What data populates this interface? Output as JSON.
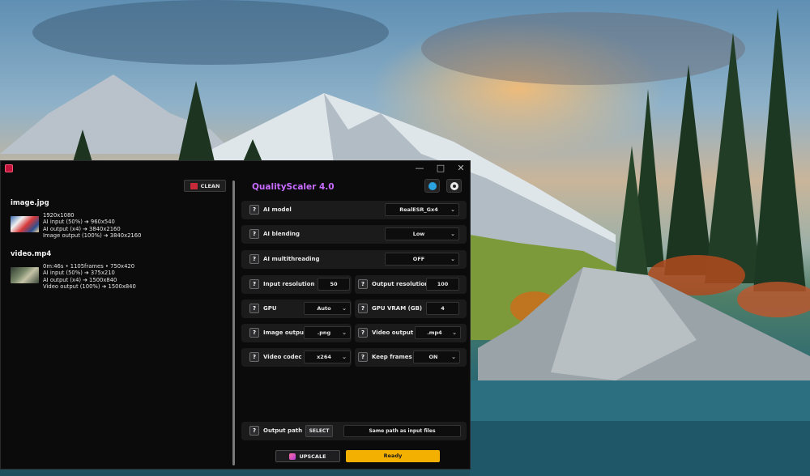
{
  "window": {
    "title_controls": [
      "—",
      "□",
      "✕"
    ]
  },
  "file_list": {
    "clean_label": "CLEAN",
    "files": [
      {
        "name": "image.jpg",
        "type": "image",
        "lines": [
          "1920x1080",
          "AI input (50%) ➔ 960x540",
          "AI output (x4) ➔ 3840x2160",
          "Image output (100%) ➔ 3840x2160"
        ]
      },
      {
        "name": "video.mp4",
        "type": "video",
        "lines": [
          "0m:46s • 1105frames • 750x420",
          "AI input (50%) ➔ 375x210",
          "AI output (x4) ➔ 1500x840",
          "Video output (100%) ➔ 1500x840"
        ]
      }
    ]
  },
  "app": {
    "title": "QualityScaler 4.0",
    "icons": [
      "telegram-icon",
      "github-icon"
    ]
  },
  "settings": {
    "help_mark": "?",
    "ai_model": {
      "label": "AI model",
      "value": "RealESR_Gx4"
    },
    "ai_blending": {
      "label": "AI blending",
      "value": "Low"
    },
    "ai_multithreading": {
      "label": "AI multithreading",
      "value": "OFF"
    },
    "input_resolution": {
      "label": "Input resolution",
      "value": "50"
    },
    "output_resolution": {
      "label": "Output resolution",
      "value": "100"
    },
    "gpu": {
      "label": "GPU",
      "value": "Auto"
    },
    "gpu_vram": {
      "label": "GPU VRAM (GB)",
      "value": "4"
    },
    "image_output": {
      "label": "Image output",
      "value": ".png"
    },
    "video_output": {
      "label": "Video output",
      "value": ".mp4"
    },
    "video_codec": {
      "label": "Video codec",
      "value": "x264"
    },
    "keep_frames": {
      "label": "Keep frames",
      "value": "ON"
    },
    "output_path": {
      "label": "Output path",
      "select_label": "SELECT",
      "value": "Same path as input files"
    }
  },
  "actions": {
    "upscale_label": "UPSCALE",
    "status": "Ready"
  },
  "colors": {
    "accent_title": "#c86bff",
    "status_bg": "#f4b000"
  }
}
